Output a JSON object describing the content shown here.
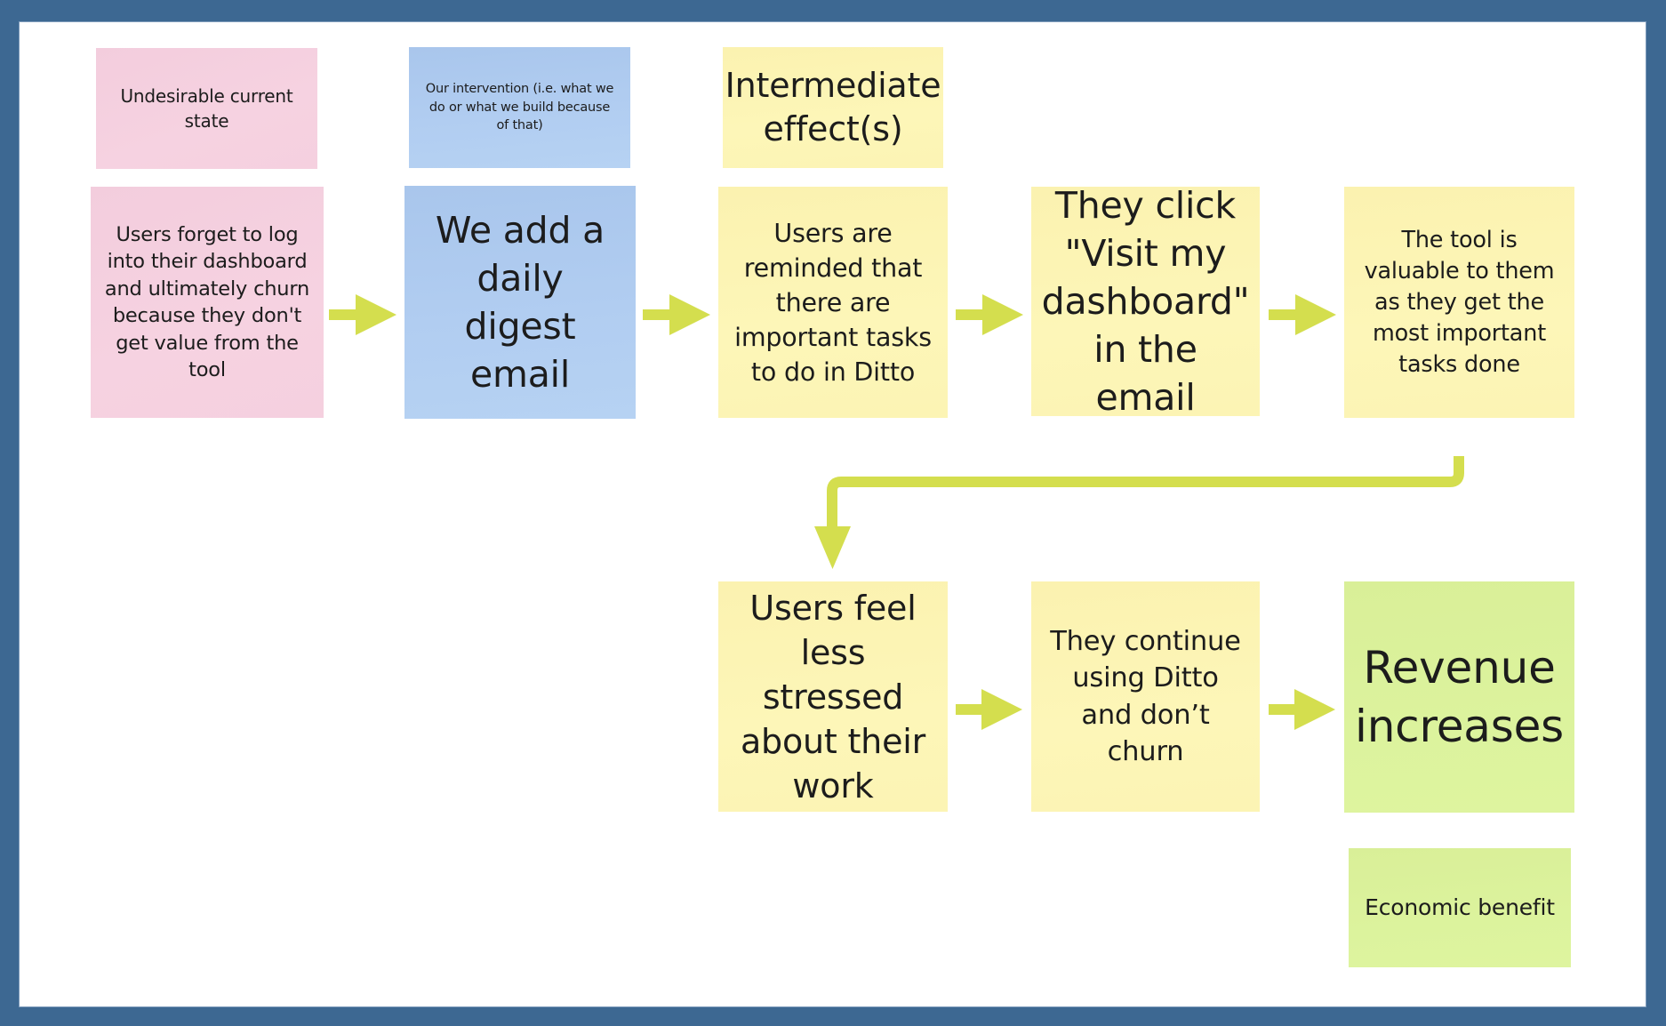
{
  "colors": {
    "frame": "#3d6892",
    "canvas": "#ffffff",
    "arrow": "#d4de4e",
    "pink_note": "#f6d2e1",
    "blue_note": "#b1cdf1",
    "yellow_note": "#fdf6b8",
    "green_note": "#dcf39d",
    "text": "#1c1c1c"
  },
  "legend_notes": {
    "undesirable_state": "Undesirable current state",
    "intervention": "Our intervention (i.e. what we do or what we build because of that)",
    "intermediate_effects": "Intermediate effect(s)",
    "economic_benefit": "Economic benefit"
  },
  "flow": {
    "problem": "Users forget to log into their dashboard and ultimately churn because they don't get value from the tool",
    "intervention": "We add a daily digest email",
    "effect_1": "Users are reminded that there are important tasks to do in Ditto",
    "effect_2": "They click \"Visit my dashboard\" in the email",
    "effect_3": "The tool is valuable to them as they get the most important tasks done",
    "effect_4": "Users feel less stressed about their work",
    "effect_5": "They continue using Ditto and don’t churn",
    "outcome": "Revenue increases"
  },
  "connections": [
    [
      "problem",
      "intervention"
    ],
    [
      "intervention",
      "effect_1"
    ],
    [
      "effect_1",
      "effect_2"
    ],
    [
      "effect_2",
      "effect_3"
    ],
    [
      "effect_3",
      "effect_4"
    ],
    [
      "effect_4",
      "effect_5"
    ],
    [
      "effect_5",
      "outcome"
    ]
  ]
}
